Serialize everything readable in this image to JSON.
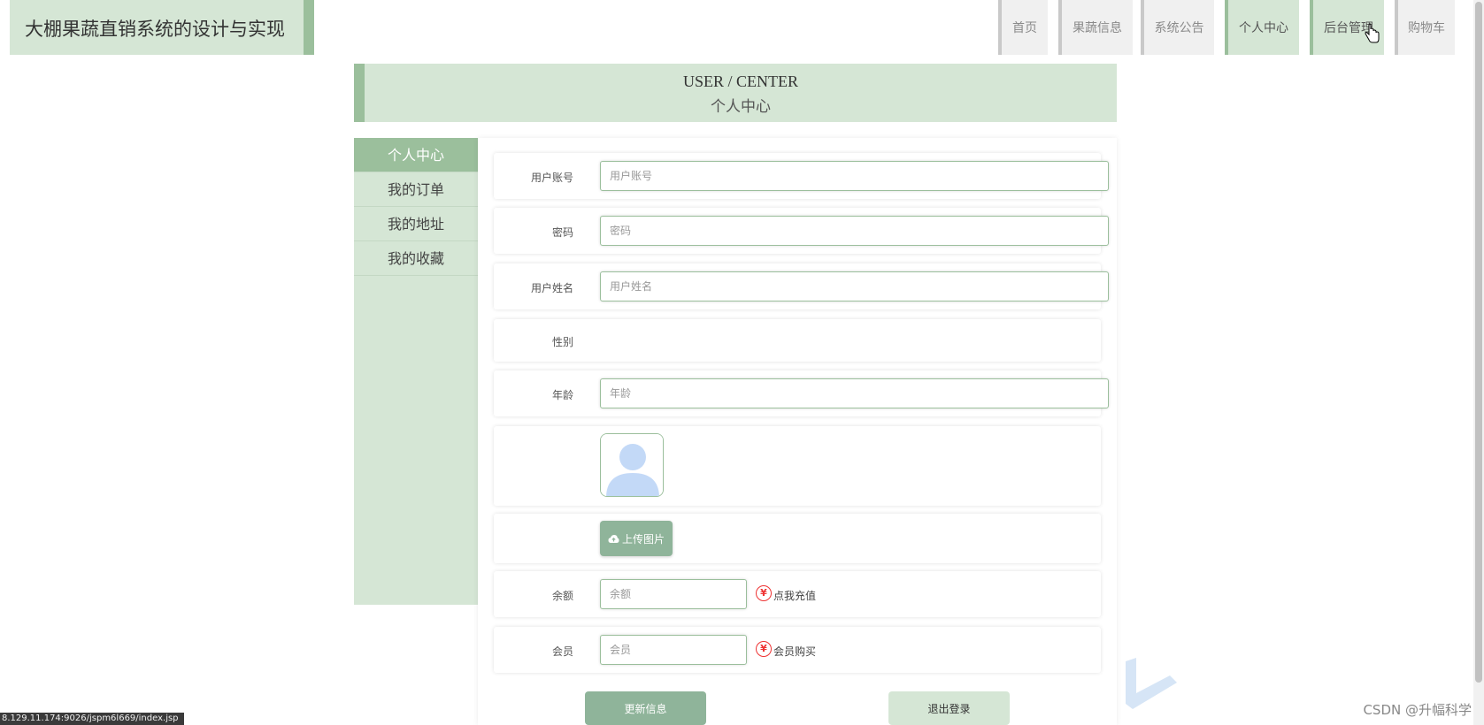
{
  "header": {
    "title": "大棚果蔬直销系统的设计与实现",
    "nav": [
      "首页",
      "果蔬信息",
      "系统公告",
      "个人中心",
      "后台管理",
      "购物车"
    ]
  },
  "banner": {
    "en": "USER / CENTER",
    "cn": "个人中心"
  },
  "sidebar": {
    "items": [
      "个人中心",
      "我的订单",
      "我的地址",
      "我的收藏"
    ]
  },
  "form": {
    "account_label": "用户账号",
    "account_placeholder": "用户账号",
    "password_label": "密码",
    "password_placeholder": "密码",
    "name_label": "用户姓名",
    "name_placeholder": "用户姓名",
    "gender_label": "性别",
    "age_label": "年龄",
    "age_placeholder": "年龄",
    "upload_label": "上传图片",
    "balance_label": "余额",
    "balance_placeholder": "余额",
    "recharge_link": "点我充值",
    "member_label": "会员",
    "member_placeholder": "会员",
    "member_buy_link": "会员购买",
    "yen_symbol": "¥",
    "update_button": "更新信息",
    "logout_button": "退出登录"
  },
  "status_url": "8.129.11.174:9026/jspm6l669/index.jsp",
  "watermark": "CSDN @升幅科学",
  "colors": {
    "accent_light": "#d5e6d5",
    "accent": "#9bbf9c",
    "button": "#8fb49a"
  }
}
